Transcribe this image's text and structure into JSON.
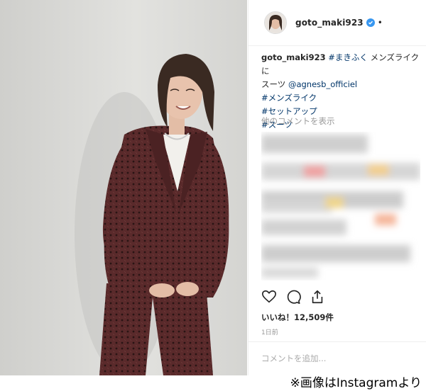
{
  "post": {
    "username": "goto_maki923",
    "separator": "•",
    "caption": {
      "username": "goto_maki923",
      "line1_tag": "#まきふく",
      "line1_text": " メンズライクに",
      "line2_text": "スーツ ",
      "mention": "@agnesb_officiel",
      "hashtags": [
        "#メンズライク",
        "#セットアップ",
        "#スーツ"
      ]
    },
    "view_more_comments": "他のコメントを表示",
    "likes": "いいね！12,509件",
    "time_ago": "1日前",
    "comment_placeholder": "コメントを追加..."
  },
  "credit": "※画像はInstagramより",
  "colors": {
    "link": "#003569",
    "verified": "#3897f0",
    "muted": "#999999",
    "suit": "#5a2a2b"
  },
  "icons": [
    "heart-icon",
    "comment-icon",
    "share-icon",
    "verified-badge-icon"
  ]
}
